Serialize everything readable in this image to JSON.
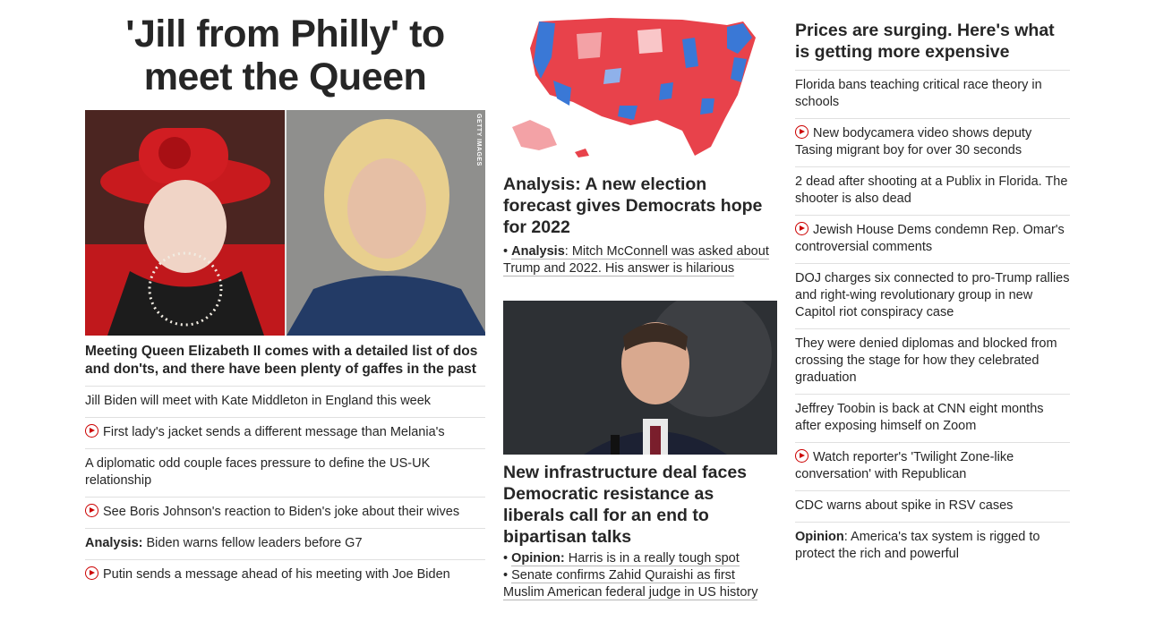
{
  "left": {
    "hero_title": "'Jill from Philly' to meet the Queen",
    "image_credit": "GETTY IMAGES",
    "lead": "Meeting Queen Elizabeth II comes with a detailed list of dos and don'ts, and there have been plenty of gaffes in the past",
    "items": [
      {
        "text": "Jill Biden will meet with Kate Middleton in England this week",
        "video": false,
        "prefix": ""
      },
      {
        "text": "First lady's jacket sends a different message than Melania's",
        "video": true,
        "prefix": ""
      },
      {
        "text": "A diplomatic odd couple faces pressure to define the US-UK relationship",
        "video": false,
        "prefix": ""
      },
      {
        "text": "See Boris Johnson's reaction to Biden's joke about their wives",
        "video": true,
        "prefix": ""
      },
      {
        "text": " Biden warns fellow leaders before G7",
        "video": false,
        "prefix": "Analysis:"
      },
      {
        "text": "Putin sends a message ahead of his meeting with Joe Biden",
        "video": true,
        "prefix": ""
      }
    ]
  },
  "middle": {
    "story1": {
      "headline": "Analysis: A new election forecast gives Democrats hope for 2022",
      "sub_bullet": "•",
      "sub_prefix": "Analysis",
      "sub_text": ": Mitch McConnell was asked about Trump and 2022. His answer is hilarious"
    },
    "story2": {
      "headline": "New infrastructure deal faces Democratic resistance as liberals call for an end to bipartisan talks",
      "subs": [
        {
          "bullet": "•",
          "prefix": "Opinion:",
          "text": " Harris is in a really tough spot"
        },
        {
          "bullet": "•",
          "prefix": "",
          "text": "Senate confirms Zahid Quraishi as first Muslim American federal judge in US history"
        }
      ]
    }
  },
  "right": {
    "headline": "Prices are surging. Here's what is getting more expensive",
    "items": [
      {
        "text": "Florida bans teaching critical race theory in schools",
        "video": false,
        "prefix": ""
      },
      {
        "text": "New bodycamera video shows deputy Tasing migrant boy for over 30 seconds",
        "video": true,
        "prefix": ""
      },
      {
        "text": "2 dead after shooting at a Publix in Florida. The shooter is also dead",
        "video": false,
        "prefix": ""
      },
      {
        "text": "Jewish House Dems condemn Rep. Omar's controversial comments",
        "video": true,
        "prefix": ""
      },
      {
        "text": "DOJ charges six connected to pro-Trump rallies and right-wing revolutionary group in new Capitol riot conspiracy case",
        "video": false,
        "prefix": ""
      },
      {
        "text": "They were denied diplomas and blocked from crossing the stage for how they celebrated graduation",
        "video": false,
        "prefix": ""
      },
      {
        "text": "Jeffrey Toobin is back at CNN eight months after exposing himself on Zoom",
        "video": false,
        "prefix": ""
      },
      {
        "text": "Watch reporter's 'Twilight Zone-like conversation' with Republican",
        "video": true,
        "prefix": ""
      },
      {
        "text": "CDC warns about spike in RSV cases",
        "video": false,
        "prefix": ""
      },
      {
        "text": ": America's tax system is rigged to protect the rich and powerful",
        "video": false,
        "prefix": "Opinion"
      }
    ]
  },
  "colors": {
    "text": "#262626",
    "divider": "#e0e0e0",
    "video_red": "#cc0000",
    "map_red": "#e8424b",
    "map_blue": "#3a78d6"
  }
}
